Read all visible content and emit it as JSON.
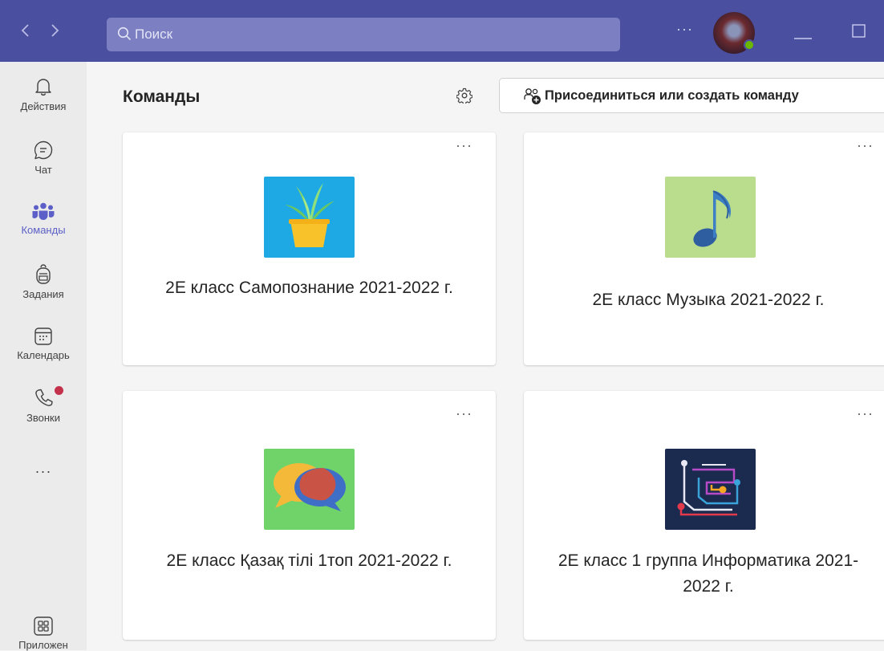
{
  "search": {
    "placeholder": "Поиск"
  },
  "rail": {
    "items": [
      {
        "label": "Действия",
        "icon": "bell-icon"
      },
      {
        "label": "Чат",
        "icon": "chat-icon"
      },
      {
        "label": "Команды",
        "icon": "teams-icon",
        "active": true
      },
      {
        "label": "Задания",
        "icon": "backpack-icon"
      },
      {
        "label": "Календарь",
        "icon": "calendar-icon"
      },
      {
        "label": "Звонки",
        "icon": "phone-icon",
        "badge": true
      }
    ],
    "more": "···",
    "apps_label": "Приложен"
  },
  "header": {
    "title": "Команды",
    "join_button": "Присоединиться или создать команду"
  },
  "teams": [
    {
      "name": "2E класс Самопознание 2021-2022 г.",
      "tile": "plant",
      "tile_color": "#1fa9e4"
    },
    {
      "name": "2E класс Музыка 2021-2022 г.",
      "tile": "note",
      "tile_color": "#b9dc8d"
    },
    {
      "name": "2E класс Қазақ тілі 1топ 2021-2022 г.",
      "tile": "speech",
      "tile_color": "#6fd36a"
    },
    {
      "name": "2E класс 1 группа Информатика 2021-2022 г.",
      "tile": "circuit",
      "tile_color": "#1a2b4f"
    }
  ],
  "colors": {
    "brand": "#4b4f9f",
    "accent": "#5b5fc7",
    "badge": "#c4314b"
  }
}
